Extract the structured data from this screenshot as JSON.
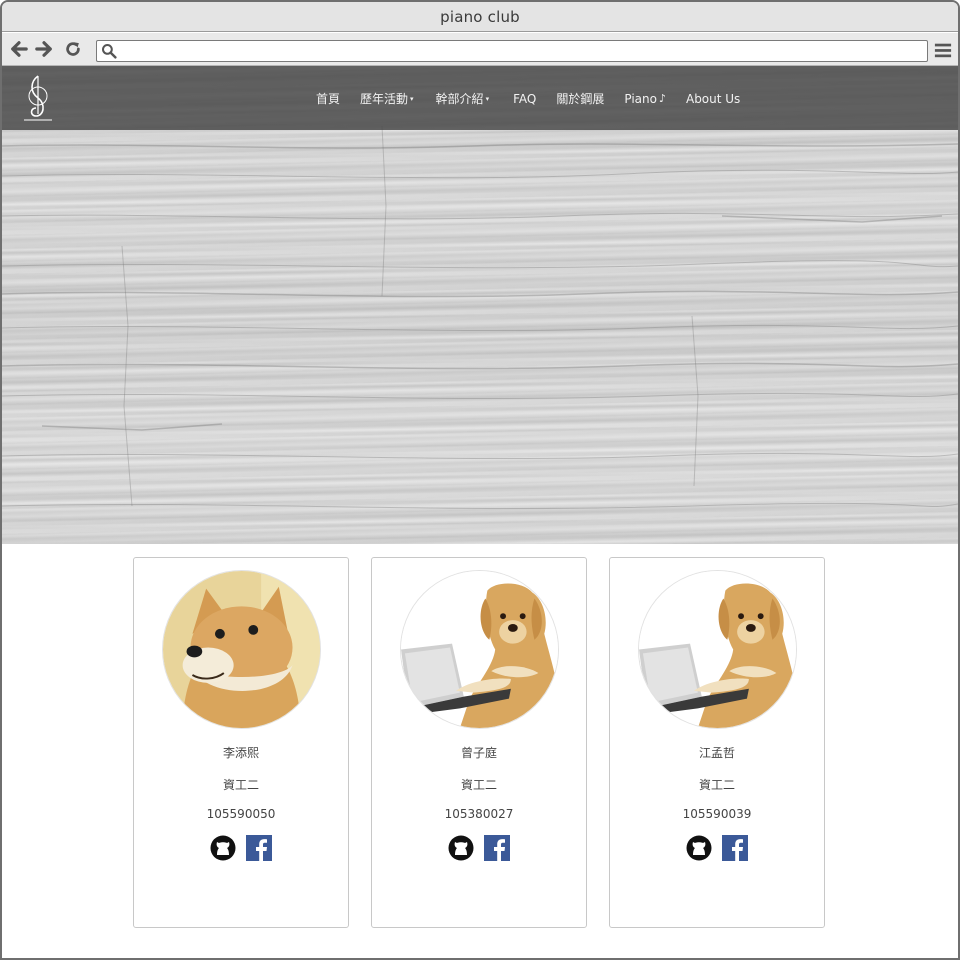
{
  "browser": {
    "title": "piano club",
    "address_value": "",
    "icons": [
      "back-arrow-icon",
      "forward-arrow-icon",
      "reload-icon",
      "search-icon",
      "menu-icon"
    ]
  },
  "site": {
    "nav": [
      {
        "label": "首頁",
        "caret": ""
      },
      {
        "label": "歷年活動",
        "caret": "▾"
      },
      {
        "label": "幹部介紹",
        "caret": "▾"
      },
      {
        "label": "FAQ",
        "caret": ""
      },
      {
        "label": "關於鋼展",
        "caret": ""
      },
      {
        "label": "Piano",
        "caret": "♪"
      },
      {
        "label": "About Us",
        "caret": ""
      }
    ],
    "colors": {
      "navbar": "#464646",
      "nav_text": "#f2f2f2",
      "facebook": "#3b5998",
      "github": "#111111"
    }
  },
  "members": [
    {
      "name": "李添熙",
      "dept": "資工二",
      "id": "105590050",
      "avatar": "shiba-doge-avatar"
    },
    {
      "name": "曾子庭",
      "dept": "資工二",
      "id": "105380027",
      "avatar": "dog-laptop-avatar"
    },
    {
      "name": "江孟哲",
      "dept": "資工二",
      "id": "105590039",
      "avatar": "dog-laptop-avatar"
    }
  ]
}
